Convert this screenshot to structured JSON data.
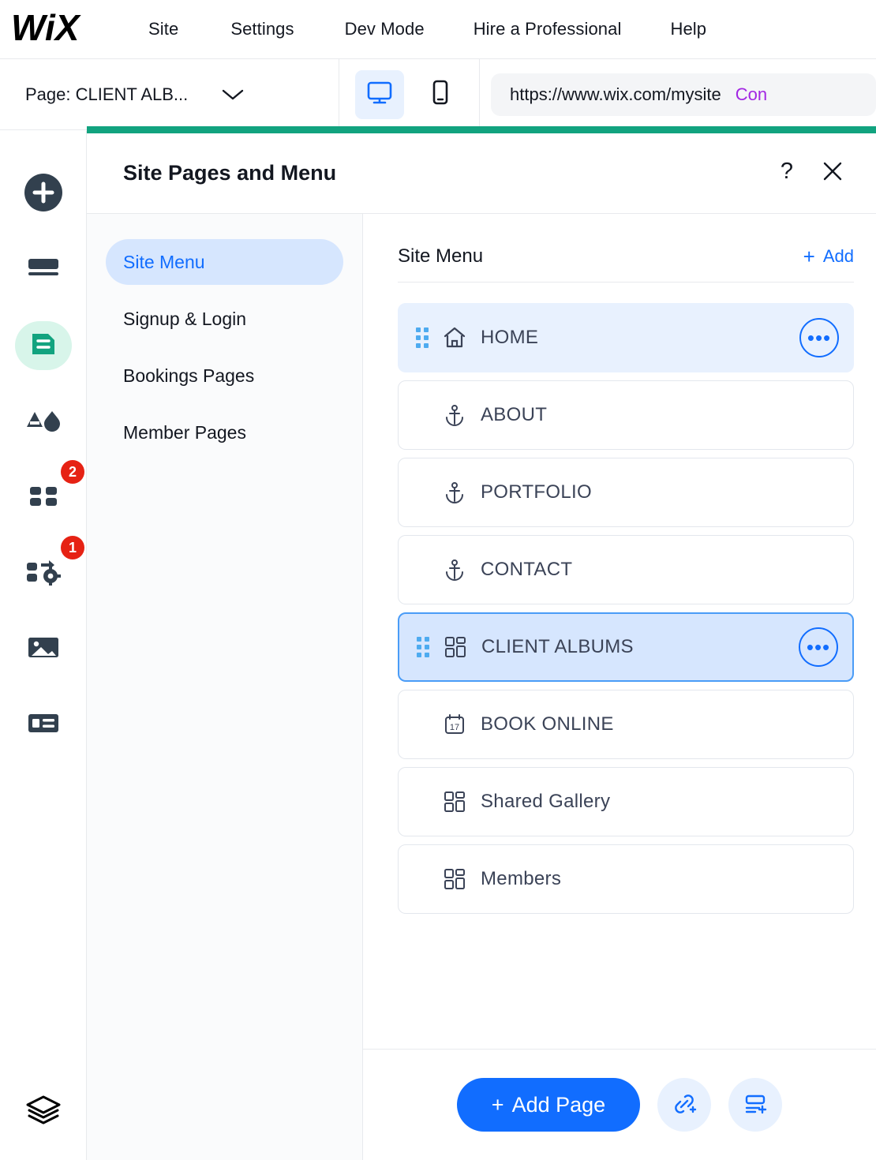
{
  "topbar": {
    "logo": "WIX",
    "menu": [
      {
        "label": "Site",
        "name": "topnav-site"
      },
      {
        "label": "Settings",
        "name": "topnav-settings"
      },
      {
        "label": "Dev Mode",
        "name": "topnav-dev-mode"
      },
      {
        "label": "Hire a Professional",
        "name": "topnav-hire-a-professional"
      },
      {
        "label": "Help",
        "name": "topnav-help"
      }
    ]
  },
  "secondbar": {
    "page_selector_label": "Page: CLIENT ALB...",
    "viewport": {
      "desktop_icon": "desktop-icon",
      "mobile_icon": "mobile-icon",
      "active": "desktop"
    },
    "url": "https://www.wix.com/mysite",
    "connect_label": "Con"
  },
  "leftrail": {
    "items": [
      {
        "name": "add-elements-button",
        "icon": "plus-circle-icon",
        "badge": null,
        "active": false
      },
      {
        "name": "site-design-button",
        "icon": "layout-bars-icon",
        "badge": null,
        "active": false
      },
      {
        "name": "site-pages-button",
        "icon": "pages-document-icon",
        "badge": null,
        "active": true
      },
      {
        "name": "theme-manager-button",
        "icon": "text-and-color-icon",
        "badge": null,
        "active": false
      },
      {
        "name": "apps-market-button",
        "icon": "four-squares-icon",
        "badge": "2",
        "active": false
      },
      {
        "name": "my-business-button",
        "icon": "puzzle-gear-icon",
        "badge": "1",
        "active": false
      },
      {
        "name": "media-manager-button",
        "icon": "image-icon",
        "badge": null,
        "active": false
      },
      {
        "name": "content-manager-button",
        "icon": "table-list-icon",
        "badge": null,
        "active": false
      }
    ],
    "bottom_item": {
      "name": "layers-button",
      "icon": "layers-icon"
    }
  },
  "panel": {
    "title": "Site Pages and Menu",
    "help_icon": "question-mark-icon",
    "close_icon": "close-x-icon",
    "nav": [
      {
        "label": "Site Menu",
        "name": "panel-nav-site-menu",
        "active": true
      },
      {
        "label": "Signup & Login",
        "name": "panel-nav-signup-login",
        "active": false
      },
      {
        "label": "Bookings Pages",
        "name": "panel-nav-bookings-pages",
        "active": false
      },
      {
        "label": "Member Pages",
        "name": "panel-nav-member-pages",
        "active": false
      }
    ],
    "section": {
      "title": "Site Menu",
      "add_plus": "+",
      "add_label": "Add"
    },
    "pages": [
      {
        "label": "HOME",
        "icon": "home-icon",
        "state": "highlight",
        "drag": true,
        "more": true,
        "more_glyph": "•••"
      },
      {
        "label": "ABOUT",
        "icon": "anchor-icon",
        "state": "normal",
        "drag": false,
        "more": false,
        "more_glyph": ""
      },
      {
        "label": "PORTFOLIO",
        "icon": "anchor-icon",
        "state": "normal",
        "drag": false,
        "more": false,
        "more_glyph": ""
      },
      {
        "label": "CONTACT",
        "icon": "anchor-icon",
        "state": "normal",
        "drag": false,
        "more": false,
        "more_glyph": ""
      },
      {
        "label": "CLIENT ALBUMS",
        "icon": "grid-dashboard-icon",
        "state": "selected",
        "drag": true,
        "more": true,
        "more_glyph": "•••"
      },
      {
        "label": "BOOK ONLINE",
        "icon": "calendar-17-icon",
        "state": "normal",
        "drag": false,
        "more": false,
        "more_glyph": ""
      },
      {
        "label": "Shared Gallery",
        "icon": "grid-dashboard-icon",
        "state": "normal",
        "drag": false,
        "more": false,
        "more_glyph": ""
      },
      {
        "label": "Members",
        "icon": "grid-dashboard-icon",
        "state": "normal",
        "drag": false,
        "more": false,
        "more_glyph": ""
      }
    ],
    "footer": {
      "add_page_plus": "+",
      "add_page_label": "Add Page",
      "link_button_icon": "link-plus-icon",
      "dropdown_button_icon": "dropdown-plus-icon"
    }
  },
  "colors": {
    "brand_green": "#12a37f",
    "accent_blue": "#116dff",
    "badge_red": "#e62214",
    "highlight_blue": "#e8f1fe",
    "selected_blue": "#d6e6fe",
    "connect_purple": "#a226e3",
    "drag_dot_blue": "#4eabf0"
  }
}
